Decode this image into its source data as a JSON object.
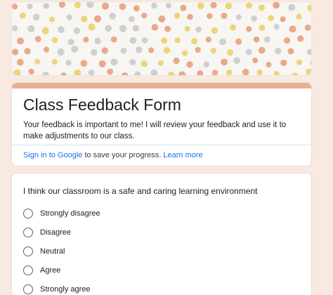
{
  "form": {
    "title": "Class Feedback Form",
    "description": "Your feedback is important to me! I will review your feedback and use it to make adjustments to our class.",
    "signin_link": "Sign in to Google",
    "signin_text": " to save your progress. ",
    "learn_more": "Learn more"
  },
  "question": {
    "text": "I think our classroom is a safe and caring learning environment",
    "options": [
      "Strongly disagree",
      "Disagree",
      "Neutral",
      "Agree",
      "Strongly agree"
    ]
  },
  "theme": {
    "accent_color": "#e8b18f",
    "link_color": "#1a73e8",
    "page_background": "#f8e9e1",
    "dot_colors": [
      "#e9a98a",
      "#ecd57a",
      "#cfcfcf"
    ]
  }
}
